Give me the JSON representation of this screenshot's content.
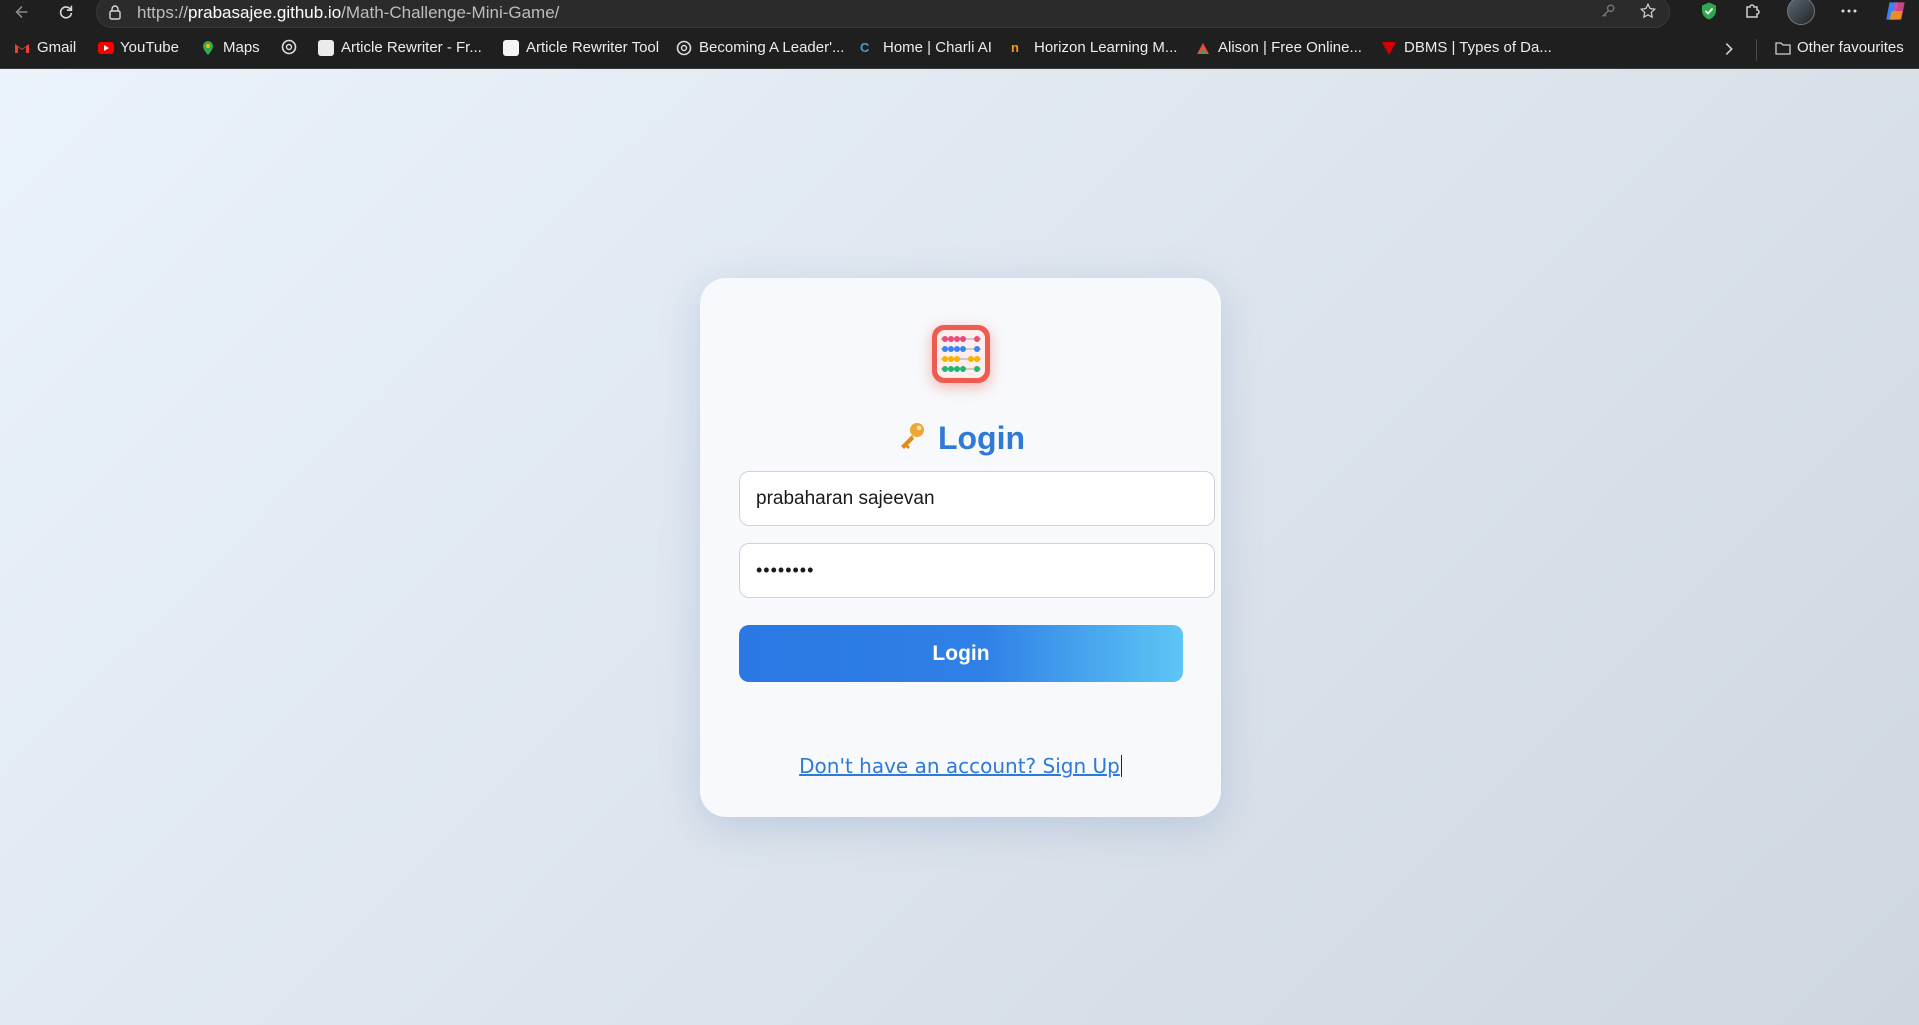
{
  "browser": {
    "url_prefix": "https://",
    "url_host": "prabasajee.github.io",
    "url_path": "/Math-Challenge-Mini-Game/",
    "bookmarks": [
      {
        "label": "Gmail",
        "color": "#ea4335"
      },
      {
        "label": "YouTube",
        "color": "#ff0000"
      },
      {
        "label": "Maps",
        "color": "#34a853"
      },
      {
        "label": "",
        "color": "#cccccc"
      },
      {
        "label": "Article Rewriter - Fr...",
        "color": "#e8e8e8"
      },
      {
        "label": "Article Rewriter Tool",
        "color": "#f0f0f0"
      },
      {
        "label": "Becoming A Leader'...",
        "color": "#cccccc"
      },
      {
        "label": "Home | Charli AI",
        "color": "#3aa0d8"
      },
      {
        "label": "Horizon Learning M...",
        "color": "#f39c12"
      },
      {
        "label": "Alison | Free Online...",
        "color": "#e74c3c"
      },
      {
        "label": "DBMS | Types of Da...",
        "color": "#d50000"
      }
    ],
    "other_favourites": "Other favourites"
  },
  "login": {
    "title": "Login",
    "username_value": "prabaharan sajeevan",
    "password_value": "••••••••",
    "button_label": "Login",
    "signup_link": "Don't have an account? Sign Up"
  },
  "colors": {
    "accent": "#2f7ad6",
    "logo": "#ee5b4f"
  }
}
